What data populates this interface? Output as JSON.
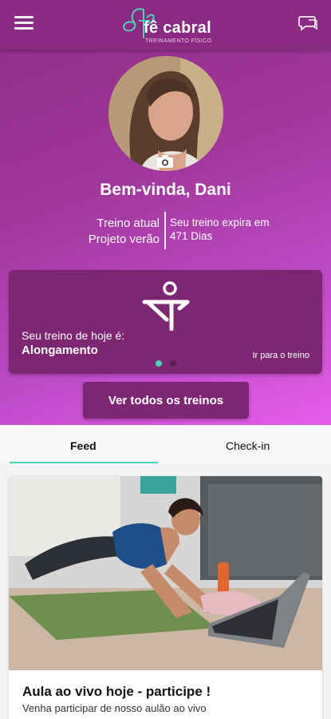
{
  "header": {
    "logo_name": "fê cabral",
    "logo_subtitle": "TREINAMENTO FÍSICO",
    "menu_icon": "hamburger-menu-icon",
    "chat_icon": "chat-bubble-icon"
  },
  "profile": {
    "welcome": "Bem-vinda, Dani",
    "camera_icon": "camera-icon"
  },
  "plan": {
    "current_label": "Treino atual",
    "current_name": "Projeto verão",
    "expires_label": "Seu treino expira em",
    "expires_value": "471 Dias"
  },
  "today": {
    "label": "Seu treino de hoje é:",
    "name": "Alongamento",
    "go_link": "Ir para o treino",
    "icon": "stretching-figure-icon",
    "carousel": {
      "total": 2,
      "active": 1
    }
  },
  "all_workouts_button": "Ver todos os treinos",
  "tabs": [
    {
      "label": "Feed",
      "active": true
    },
    {
      "label": "Check-in",
      "active": false
    }
  ],
  "feed": {
    "title": "Aula ao vivo hoje - participe !",
    "description": "Venha participar de nosso aulão ao vivo"
  },
  "colors": {
    "primary": "#8a2a83",
    "card": "#7d2672",
    "accent": "#4fd1b5",
    "gradient_end": "#e45ee8"
  }
}
